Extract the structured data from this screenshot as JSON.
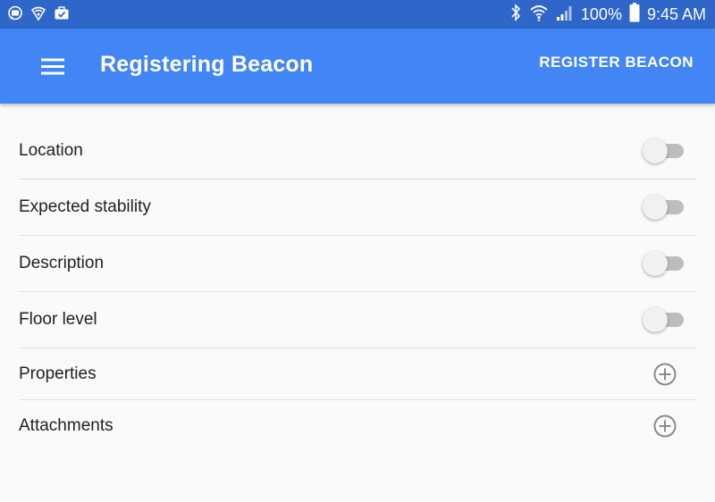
{
  "status_bar": {
    "battery_text": "100%",
    "time": "9:45 AM",
    "left_icons": [
      "chat-bubble-icon",
      "shield-wifi-icon",
      "briefcase-check-icon"
    ],
    "right_icons": [
      "bluetooth-icon",
      "wifi-icon",
      "signal-icon",
      "battery-icon"
    ]
  },
  "app_bar": {
    "title": "Registering Beacon",
    "action_label": "REGISTER BEACON",
    "menu_icon": "menu-icon"
  },
  "fields": [
    {
      "label": "Location",
      "control": "toggle",
      "on": false
    },
    {
      "label": "Expected stability",
      "control": "toggle",
      "on": false
    },
    {
      "label": "Description",
      "control": "toggle",
      "on": false
    },
    {
      "label": "Floor level",
      "control": "toggle",
      "on": false
    },
    {
      "label": "Properties",
      "control": "add",
      "icon": "add-circle-icon"
    },
    {
      "label": "Attachments",
      "control": "add",
      "icon": "add-circle-icon"
    }
  ],
  "colors": {
    "status_bar": "#2f66c9",
    "app_bar": "#4285f4",
    "background": "#fafafa",
    "divider": "#e0e0e0"
  }
}
